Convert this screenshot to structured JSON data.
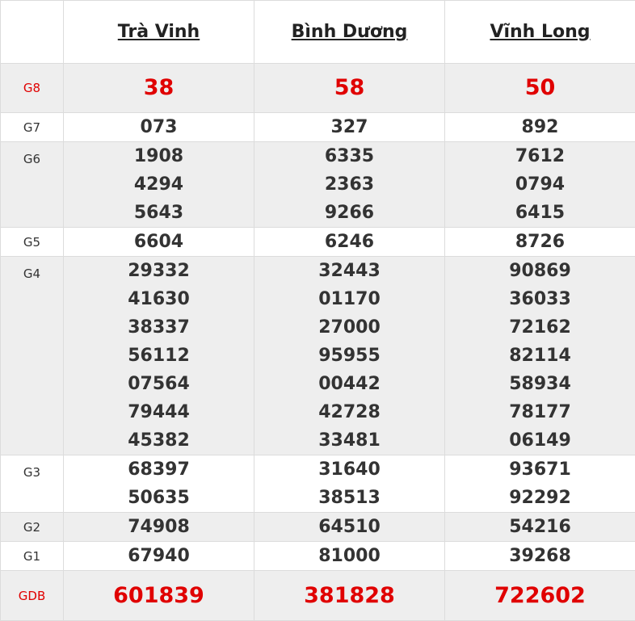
{
  "provinces": [
    "Trà Vinh",
    "Bình Dương",
    "Vĩnh Long"
  ],
  "prizes": {
    "g8": {
      "label": "G8",
      "values": [
        "38",
        "58",
        "50"
      ]
    },
    "g7": {
      "label": "G7",
      "values": [
        "073",
        "327",
        "892"
      ]
    },
    "g6": {
      "label": "G6",
      "values": [
        [
          "1908",
          "4294",
          "5643"
        ],
        [
          "6335",
          "2363",
          "9266"
        ],
        [
          "7612",
          "0794",
          "6415"
        ]
      ]
    },
    "g5": {
      "label": "G5",
      "values": [
        "6604",
        "6246",
        "8726"
      ]
    },
    "g4": {
      "label": "G4",
      "values": [
        [
          "29332",
          "41630",
          "38337",
          "56112",
          "07564",
          "79444",
          "45382"
        ],
        [
          "32443",
          "01170",
          "27000",
          "95955",
          "00442",
          "42728",
          "33481"
        ],
        [
          "90869",
          "36033",
          "72162",
          "82114",
          "58934",
          "78177",
          "06149"
        ]
      ]
    },
    "g3": {
      "label": "G3",
      "values": [
        [
          "68397",
          "50635"
        ],
        [
          "31640",
          "38513"
        ],
        [
          "93671",
          "92292"
        ]
      ]
    },
    "g2": {
      "label": "G2",
      "values": [
        "74908",
        "64510",
        "54216"
      ]
    },
    "g1": {
      "label": "G1",
      "values": [
        "67940",
        "81000",
        "39268"
      ]
    },
    "gdb": {
      "label": "GDB",
      "values": [
        "601839",
        "381828",
        "722602"
      ]
    }
  },
  "colors": {
    "highlight": "#e00000",
    "text": "#333333",
    "shade": "#eeeeee"
  }
}
